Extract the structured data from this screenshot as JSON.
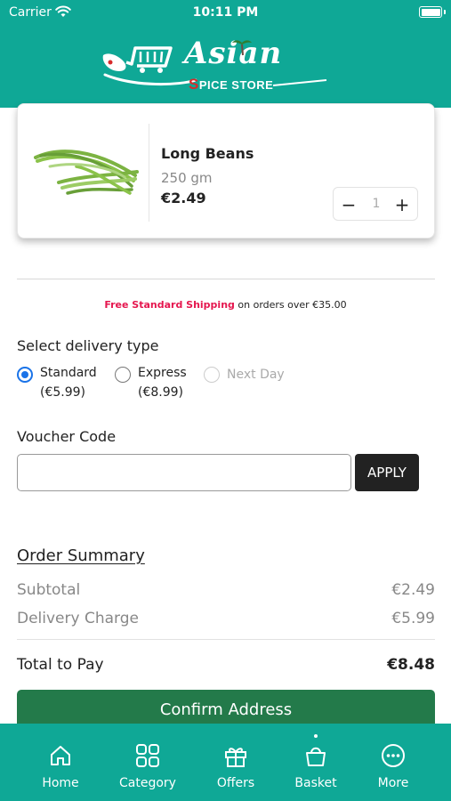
{
  "status_bar": {
    "carrier": "Carrier",
    "time": "10:11 PM"
  },
  "header": {
    "logo_main": "Asian",
    "logo_sub_initial": "S",
    "logo_sub_rest": "PICE STORE",
    "bg_color": "#0fa896"
  },
  "cart_item": {
    "name": "Long Beans",
    "weight": "250 gm",
    "price": "€2.49",
    "quantity": "1",
    "minus_symbol": "−",
    "plus_symbol": "+"
  },
  "shipping_note": {
    "highlight": "Free Standard Shipping",
    "rest": " on orders over €35.00"
  },
  "delivery": {
    "title": "Select delivery type",
    "options": [
      {
        "label": "Standard",
        "price": "(€5.99)",
        "selected": true,
        "disabled": false
      },
      {
        "label": "Express",
        "price": "(€8.99)",
        "selected": false,
        "disabled": false
      },
      {
        "label": "Next Day",
        "price": "",
        "selected": false,
        "disabled": true
      }
    ]
  },
  "voucher": {
    "title": "Voucher Code",
    "value": "",
    "placeholder": "",
    "apply_label": "APPLY"
  },
  "summary": {
    "title": "Order Summary",
    "subtotal_label": "Subtotal",
    "subtotal_value": "€2.49",
    "delivery_label": "Delivery Charge",
    "delivery_value": "€5.99",
    "total_label": "Total to Pay",
    "total_value": "€8.48"
  },
  "confirm_label": "Confirm Address",
  "tabbar": {
    "items": [
      {
        "label": "Home",
        "icon": "home-icon"
      },
      {
        "label": "Category",
        "icon": "category-icon"
      },
      {
        "label": "Offers",
        "icon": "gift-icon"
      },
      {
        "label": "Basket",
        "icon": "basket-icon",
        "active": true
      },
      {
        "label": "More",
        "icon": "more-icon"
      }
    ]
  },
  "colors": {
    "primary": "#0fa896",
    "confirm": "#237a4a",
    "shipping_highlight": "#e5174f",
    "radio_selected": "#1a73e8"
  }
}
